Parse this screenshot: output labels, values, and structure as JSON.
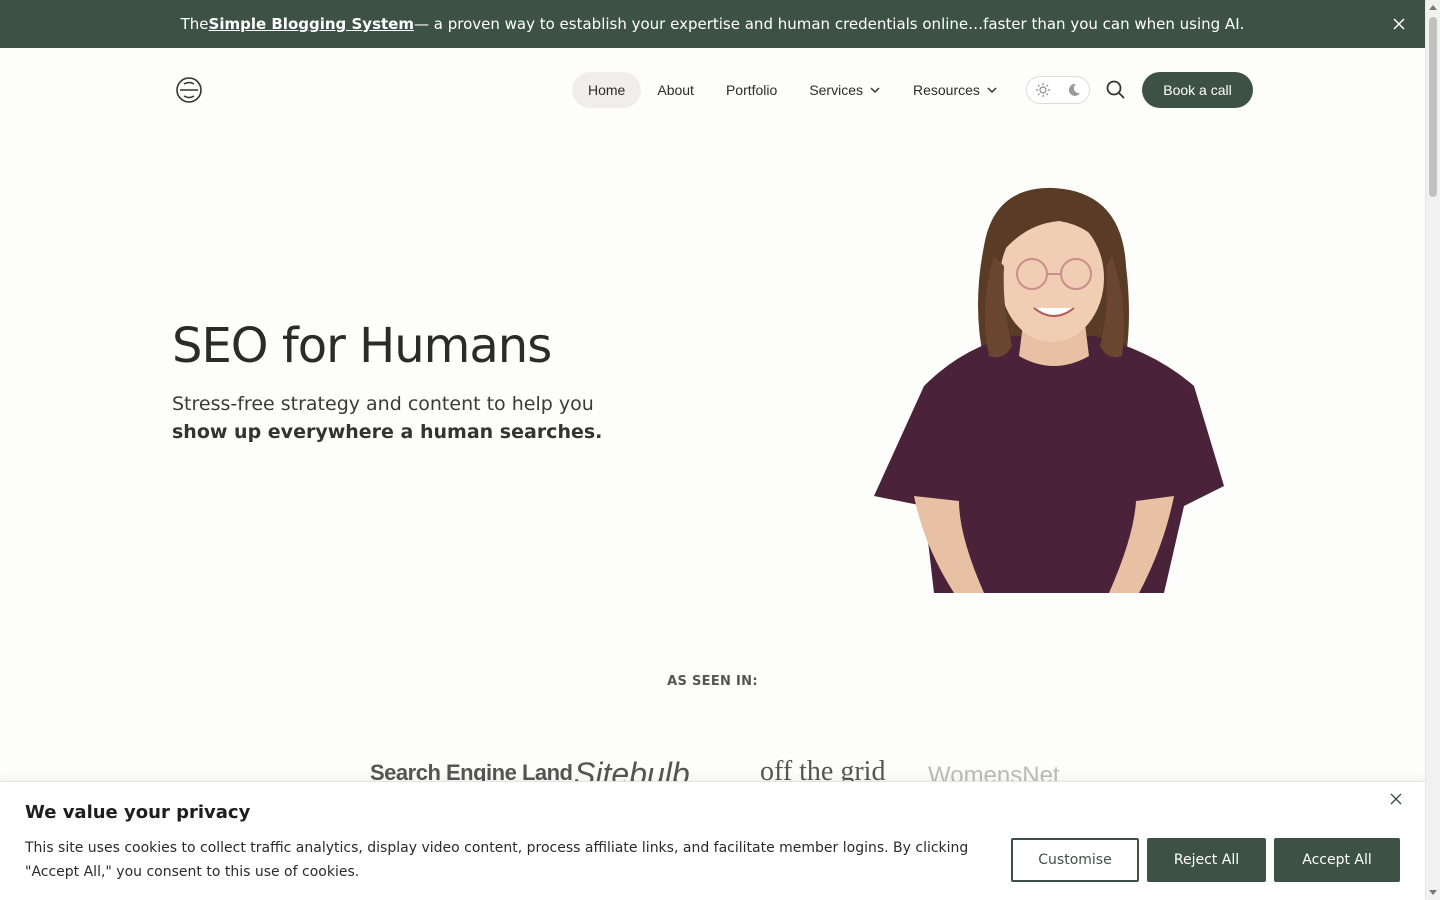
{
  "announcement": {
    "prefix": "The ",
    "link": "Simple Blogging System",
    "suffix": " — a proven way to establish your expertise and human credentials online…faster than you can when using AI."
  },
  "nav": {
    "items": [
      {
        "label": "Home",
        "active": true
      },
      {
        "label": "About"
      },
      {
        "label": "Portfolio"
      },
      {
        "label": "Services",
        "dropdown": true
      },
      {
        "label": "Resources",
        "dropdown": true
      }
    ],
    "cta": "Book a call"
  },
  "hero": {
    "title": "SEO for Humans",
    "subtitle": "Stress-free strategy and content to help you",
    "subtitle_bold": "show up everywhere a human searches."
  },
  "seen_in": {
    "label": "AS SEEN IN:",
    "logos": [
      "Search Engine Land",
      "Sitebulb",
      "off the grid",
      "WomensNet"
    ]
  },
  "cookie": {
    "title": "We value your privacy",
    "text": "This site uses cookies to collect traffic analytics, display video content, process affiliate links, and facilitate member logins. By clicking \"Accept All,\" you consent to this use of cookies.",
    "buttons": {
      "customise": "Customise",
      "reject": "Reject All",
      "accept": "Accept All"
    }
  },
  "colors": {
    "brand": "#3d5245",
    "background": "#fdfdfb",
    "shirt": "#4a2239"
  },
  "icons": [
    "close-icon",
    "sun-icon",
    "moon-icon",
    "search-icon",
    "chevron-down-icon",
    "logo-icon"
  ]
}
